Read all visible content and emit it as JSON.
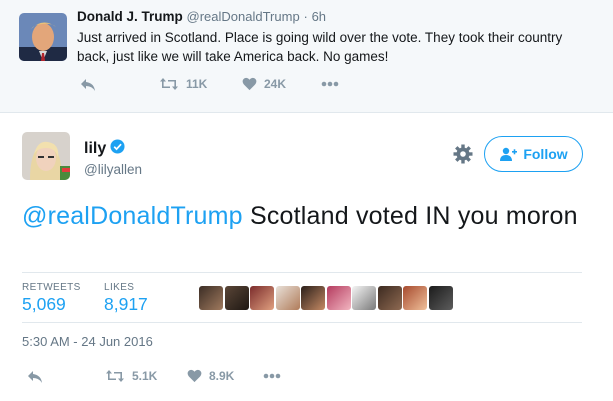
{
  "parent_tweet": {
    "name": "Donald J. Trump",
    "handle": "@realDonaldTrump",
    "separator": "·",
    "time": "6h",
    "text": "Just arrived in Scotland. Place is going wild over the vote. They took their country back, just like we will take America back. No games!",
    "retweets": "11K",
    "likes": "24K",
    "icons": [
      "reply-icon",
      "retweet-icon",
      "heart-icon",
      "more-icon"
    ]
  },
  "main_tweet": {
    "name": "lily",
    "handle": "@lilyallen",
    "mention": "@realDonaldTrump",
    "text_rest": " Scotland voted IN you moron",
    "follow_label": "Follow",
    "retweets_label": "RETWEETS",
    "retweets_value": "5,069",
    "likes_label": "LIKES",
    "likes_value": "8,917",
    "timestamp": "5:30 AM - 24 Jun 2016",
    "action_retweets": "5.1K",
    "action_likes": "8.9K",
    "liker_count": 10
  },
  "colors": {
    "accent": "#1da1f2",
    "muted": "#8899a6",
    "secondary_text": "#657786",
    "parent_bg": "#f5f8fa",
    "divider": "#e1e8ed"
  }
}
